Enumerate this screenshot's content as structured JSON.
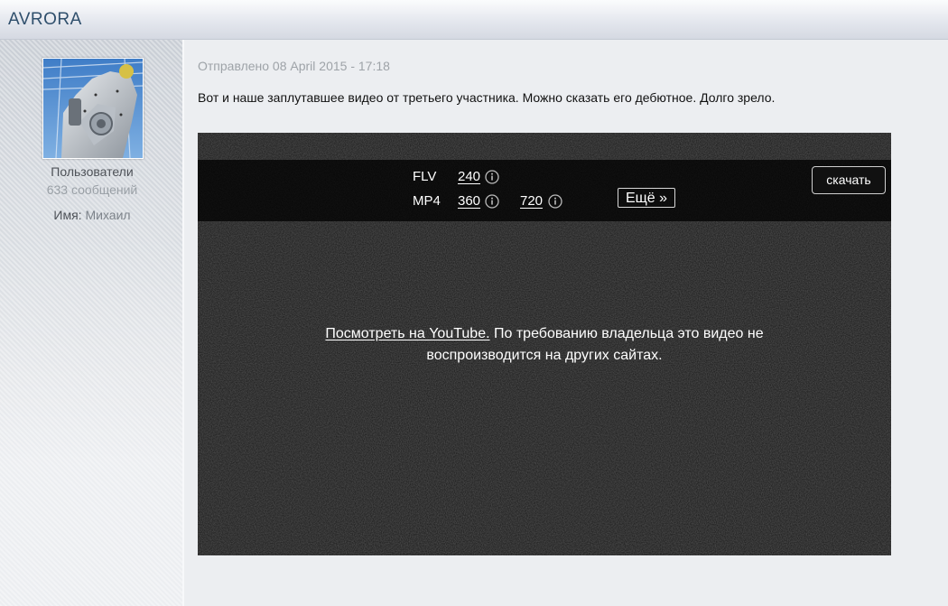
{
  "header": {
    "username": "AVRORA"
  },
  "author": {
    "group": "Пользователи",
    "posts_count": "633 сообщений",
    "name_label": "Имя:",
    "name_value": "Михаил"
  },
  "post": {
    "date": "Отправлено 08 April 2015 - 17:18",
    "text": "Вот и наше заплутавшее видео от третьего участника. Можно сказать его дебютное. Долго зрело."
  },
  "video": {
    "formats": [
      {
        "label": "FLV",
        "resolutions": [
          "240"
        ]
      },
      {
        "label": "MP4",
        "resolutions": [
          "360",
          "720"
        ]
      }
    ],
    "more_label": "Ещё »",
    "download_label": "скачать",
    "youtube_link": "Посмотреть на YouTube.",
    "blocked_message": "По требованию владельца это видео не воспроизводится на других сайтах."
  },
  "colors": {
    "username": "#2f4f6c",
    "video_bg": "#171717",
    "page_bg": "#eceef1"
  },
  "icons": [
    "info-icon",
    "avatar-image"
  ]
}
